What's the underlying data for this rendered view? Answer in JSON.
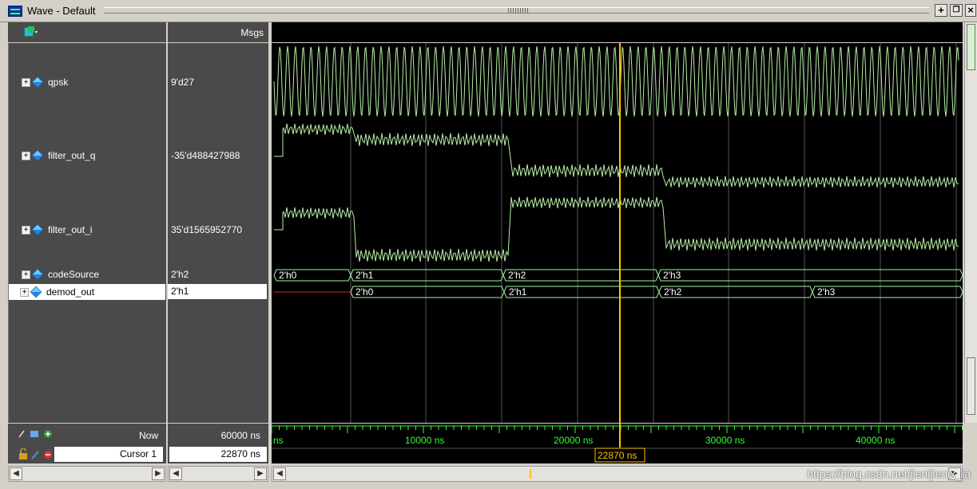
{
  "window": {
    "title": "Wave - Default"
  },
  "header": {
    "msgs_label": "Msgs"
  },
  "signals": [
    {
      "name": "qpsk",
      "value": "9'd27"
    },
    {
      "name": "filter_out_q",
      "value": "-35'd488427988"
    },
    {
      "name": "filter_out_i",
      "value": "35'd1565952770"
    },
    {
      "name": "codeSource",
      "value": "2'h2"
    },
    {
      "name": "demod_out",
      "value": "2'h1"
    }
  ],
  "bus_codeSource": [
    "2'h0",
    "2'h1",
    "2'h2",
    "2'h3"
  ],
  "bus_demod_out": [
    "2'h0",
    "2'h1",
    "2'h2",
    "2'h3"
  ],
  "status": {
    "now_label": "Now",
    "now_value": "60000 ns",
    "cursor_label": "Cursor 1",
    "cursor_value": "22870 ns"
  },
  "timeline": {
    "ticks": [
      "ns",
      "10000 ns",
      "20000 ns",
      "30000 ns",
      "40000 ns"
    ],
    "cursor_label": "22870 ns"
  },
  "watermark": "https://blog.csdn.net/jienijienix_ia",
  "colors": {
    "wave": "#b8f0a8",
    "cursor": "#ffc300",
    "bus": "#9ff5a0",
    "timeline": "#33ff33"
  }
}
